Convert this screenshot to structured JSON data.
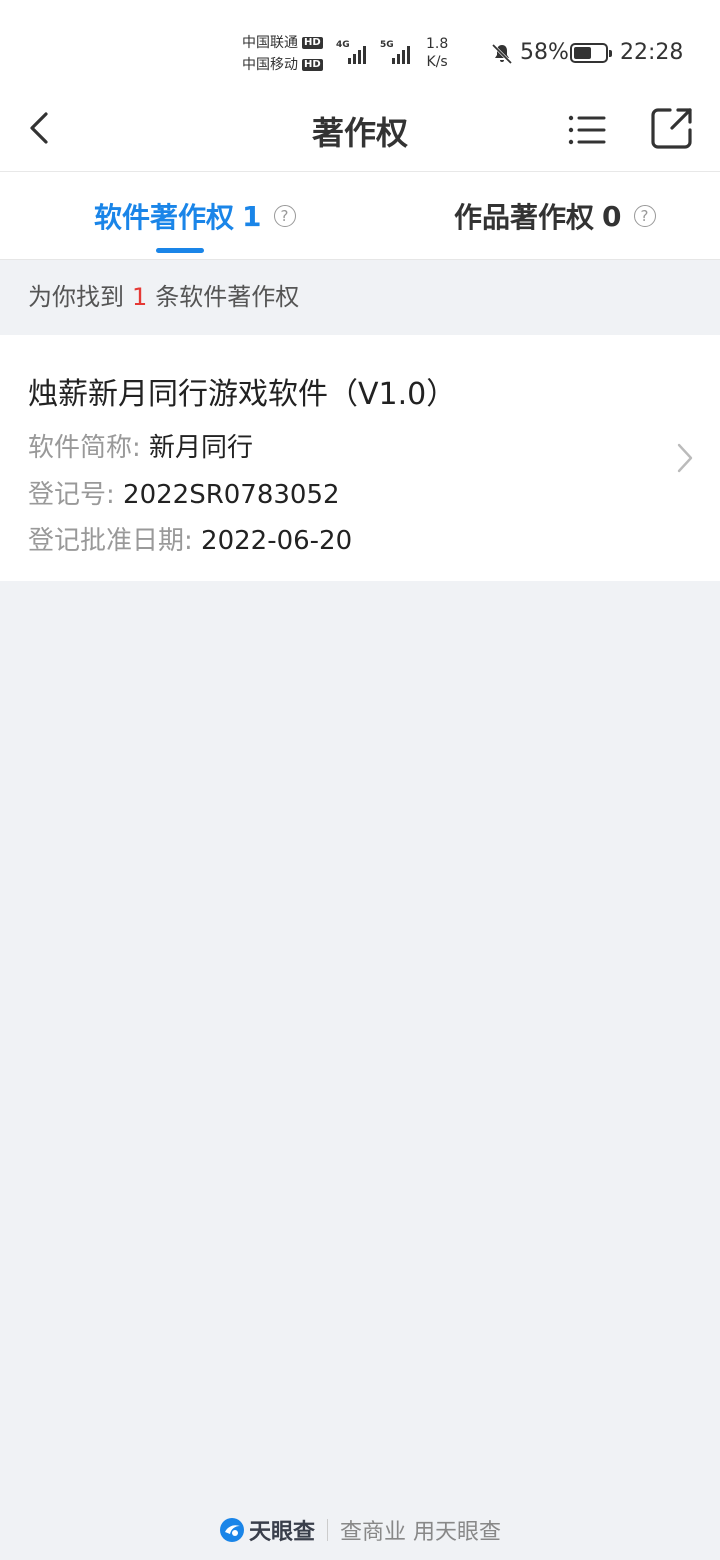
{
  "status_bar": {
    "carrier1": "中国联通",
    "carrier2": "中国移动",
    "hd": "HD",
    "net1": "4G",
    "net2": "5G",
    "speed_value": "1.8",
    "speed_unit": "K/s",
    "battery": "58%",
    "battery_level": 0.58,
    "time": "22:28"
  },
  "header": {
    "title": "著作权"
  },
  "tabs": [
    {
      "label": "软件著作权",
      "count": "1",
      "active": true
    },
    {
      "label": "作品著作权",
      "count": "0",
      "active": false
    }
  ],
  "summary": {
    "prefix": "为你找到",
    "count": "1",
    "suffix": "条软件著作权"
  },
  "results": [
    {
      "title": "烛薪新月同行游戏软件（V1.0）",
      "short_name_label": "软件简称:",
      "short_name": "新月同行",
      "reg_no_label": "登记号:",
      "reg_no": "2022SR0783052",
      "date_label": "登记批准日期:",
      "date": "2022-06-20"
    }
  ],
  "footer": {
    "brand": "天眼查",
    "slogan": "查商业 用天眼查"
  },
  "colors": {
    "accent": "#1a85e8",
    "highlight": "#e53935"
  }
}
